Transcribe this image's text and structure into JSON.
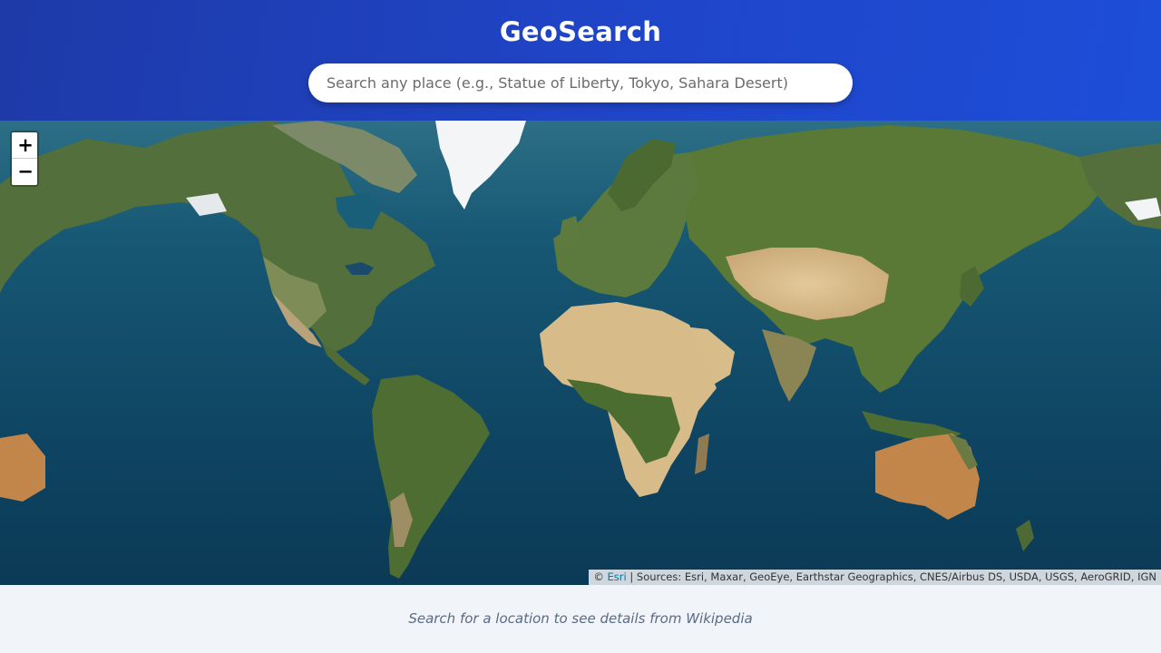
{
  "header": {
    "title": "GeoSearch",
    "search_placeholder": "Search any place (e.g., Statue of Liberty, Tokyo, Sahara Desert)",
    "search_value": "",
    "background_color": "#1f45c9"
  },
  "map": {
    "zoom_in_label": "+",
    "zoom_out_label": "−",
    "attribution": {
      "prefix": "©",
      "link_text": "Esri",
      "sources": "| Sources: Esri, Maxar, GeoEye, Earthstar Geographics, CNES/Airbus DS, USDA, USGS, AeroGRID, IGN"
    },
    "ocean_color": "#0d4360",
    "land_colors": {
      "forest": "#4d6e34",
      "desert": "#d9bf8c",
      "ice": "#f2f4f6"
    }
  },
  "footer": {
    "hint": "Search for a location to see details from Wikipedia"
  }
}
